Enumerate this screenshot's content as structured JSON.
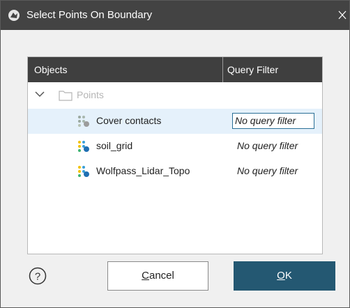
{
  "window": {
    "title": "Select Points On Boundary"
  },
  "table": {
    "columns": [
      "Objects",
      "Query Filter"
    ],
    "parent": {
      "label": "Points",
      "icon": "folder-icon",
      "expanded": true
    },
    "rows": [
      {
        "name": "Cover contacts",
        "filter": "No query filter",
        "selected": true,
        "icon": "points-object-icon"
      },
      {
        "name": "soil_grid",
        "filter": "No query filter",
        "selected": false,
        "icon": "points-object-icon"
      },
      {
        "name": "Wolfpass_Lidar_Topo",
        "filter": "No query filter",
        "selected": false,
        "icon": "points-object-icon"
      }
    ]
  },
  "buttons": {
    "help_glyph": "?",
    "cancel_mnemonic": "C",
    "cancel_rest": "ancel",
    "ok_mnemonic": "O",
    "ok_rest": "K"
  },
  "colors": {
    "titlebar": "#434343",
    "header": "#3f3f3f",
    "selected_row": "#e5f1fb",
    "ok_button": "#245872"
  }
}
